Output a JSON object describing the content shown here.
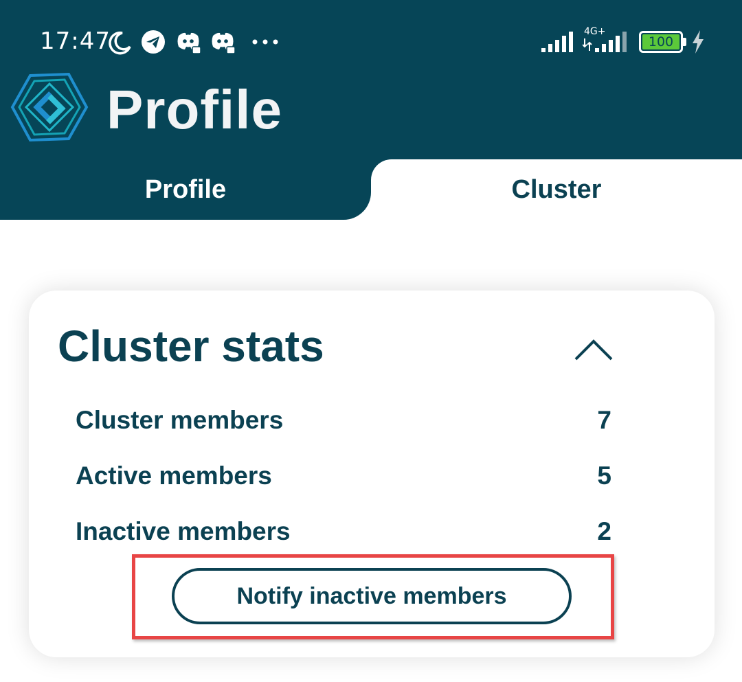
{
  "status_bar": {
    "time": "17:47",
    "icons": [
      "moon-icon",
      "telegram-icon",
      "discord-icon",
      "discord-icon",
      "more-dots-icon",
      "signal-icon",
      "signal-4g-icon",
      "battery-icon",
      "charging-icon"
    ],
    "network": "4G+",
    "battery": "100",
    "battery_color": "#5cc93a"
  },
  "header": {
    "title": "Profile",
    "background_color": "#064557",
    "logo_icon": "hexagon-logo-icon"
  },
  "tabs": [
    {
      "label": "Profile",
      "active": false
    },
    {
      "label": "Cluster",
      "active": true
    }
  ],
  "card": {
    "title": "Cluster stats",
    "collapse_icon": "chevron-up-icon",
    "stats": [
      {
        "label": "Cluster members",
        "value": "7"
      },
      {
        "label": "Active members",
        "value": "5"
      },
      {
        "label": "Inactive members",
        "value": "2"
      }
    ],
    "button_label": "Notify inactive members"
  },
  "annotation": {
    "highlight_color": "#e84545"
  }
}
